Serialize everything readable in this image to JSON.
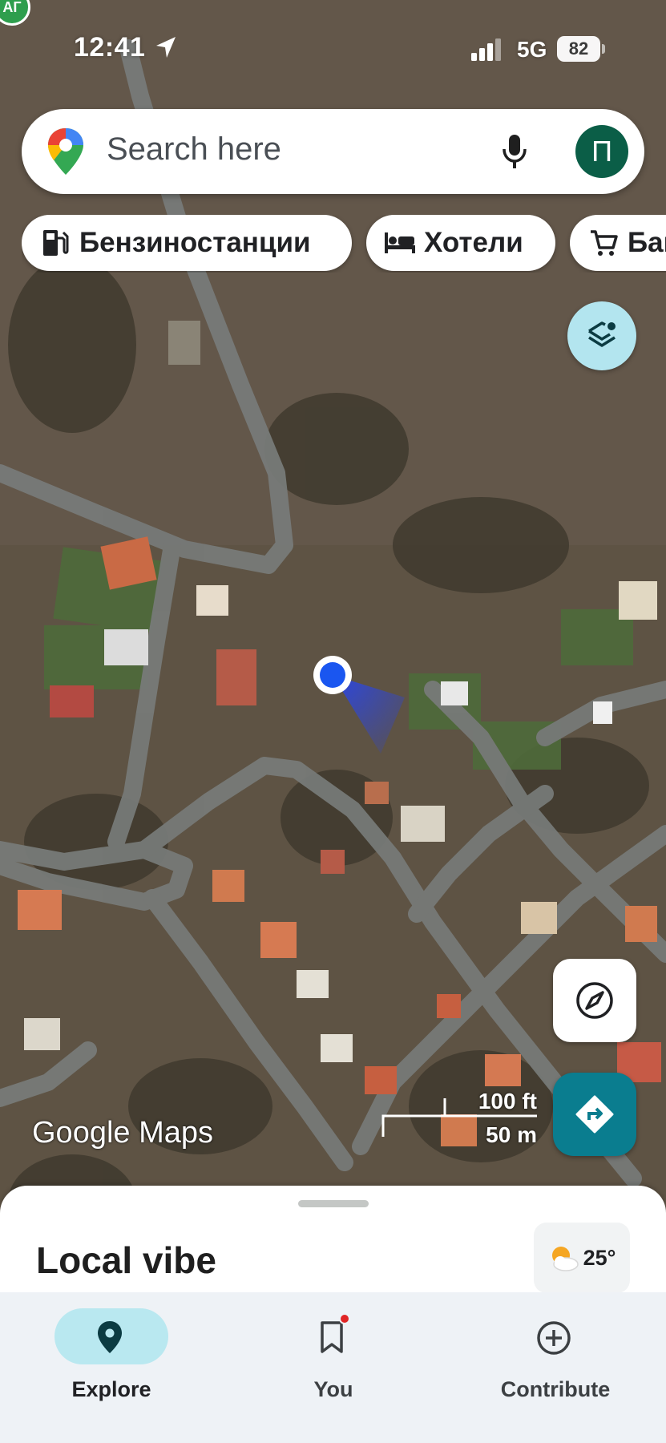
{
  "status_bar": {
    "time": "12:41",
    "network": "5G",
    "battery": "82"
  },
  "search": {
    "placeholder": "Search here",
    "avatar_initial": "П"
  },
  "chips": [
    {
      "label": "Бензиностанции",
      "icon": "gas-station-icon"
    },
    {
      "label": "Хотели",
      "icon": "hotel-bed-icon"
    },
    {
      "label": "Банки",
      "icon": "shopping-cart-icon"
    }
  ],
  "map": {
    "logo": "Google Maps",
    "scale_imperial": "100 ft",
    "scale_metric": "50 m"
  },
  "sheet": {
    "title": "Local vibe",
    "weather_temp": "25°",
    "weather_icon": "partly-cloudy-icon"
  },
  "nav": {
    "items": [
      {
        "label": "Explore",
        "icon": "location-pin-icon",
        "active": true
      },
      {
        "label": "You",
        "icon": "bookmark-icon",
        "active": false
      },
      {
        "label": "Contribute",
        "icon": "add-circle-icon",
        "active": false
      }
    ]
  },
  "colors": {
    "accent_teal": "#0a7d8f",
    "active_pill": "#b9e8f0",
    "avatar": "#0b5e47",
    "user_location": "#1a56f0"
  }
}
